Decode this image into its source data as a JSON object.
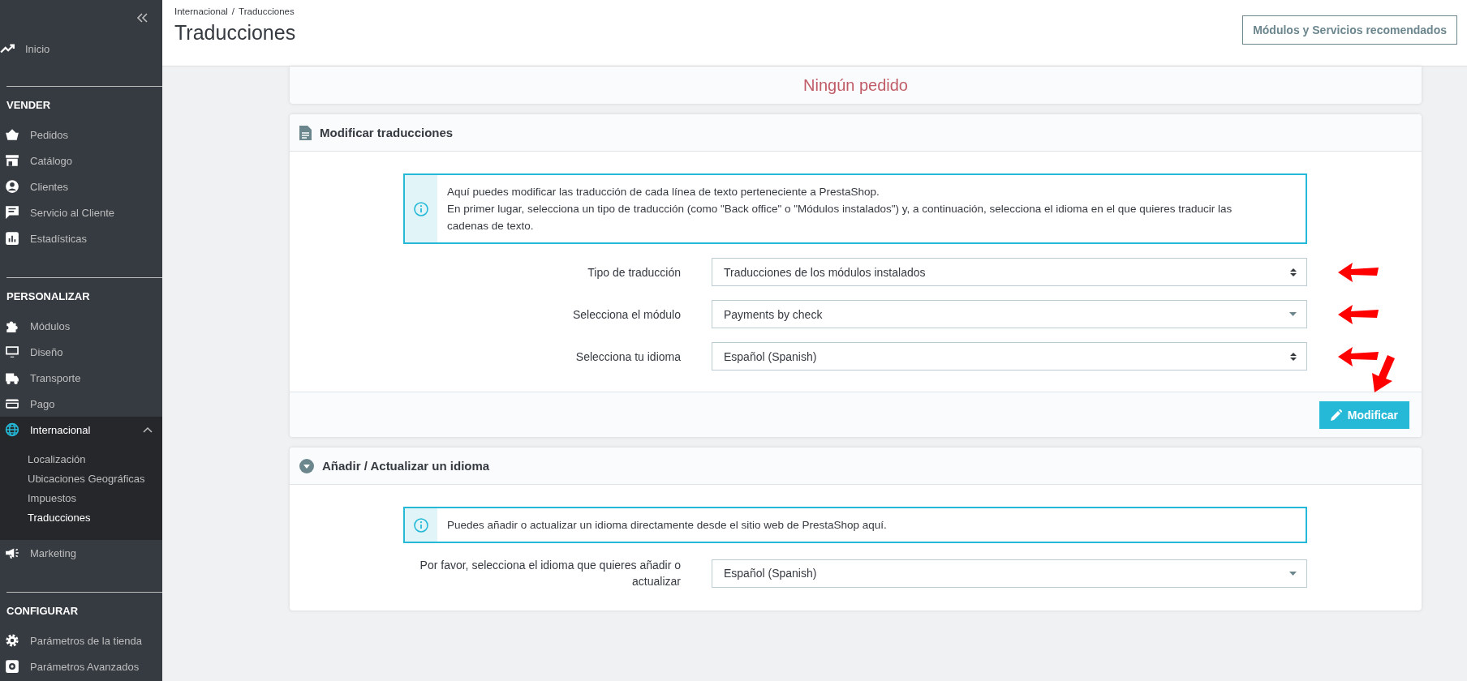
{
  "sidebar": {
    "sections": [
      {
        "items": [
          {
            "label": "Inicio",
            "selected": false
          }
        ]
      },
      {
        "heading": "VENDER",
        "items": [
          {
            "label": "Pedidos",
            "selected": false
          },
          {
            "label": "Catálogo",
            "selected": false
          },
          {
            "label": "Clientes",
            "selected": false
          },
          {
            "label": "Servicio al Cliente",
            "selected": false
          },
          {
            "label": "Estadísticas",
            "selected": false
          }
        ]
      },
      {
        "heading": "PERSONALIZAR",
        "items": [
          {
            "label": "Módulos",
            "selected": false
          },
          {
            "label": "Diseño",
            "selected": false
          },
          {
            "label": "Transporte",
            "selected": false
          },
          {
            "label": "Pago",
            "selected": false
          },
          {
            "label": "Internacional",
            "selected": true,
            "expanded": true,
            "children": [
              {
                "label": "Localización",
                "selected": false
              },
              {
                "label": "Ubicaciones Geográficas",
                "selected": false
              },
              {
                "label": "Impuestos",
                "selected": false
              },
              {
                "label": "Traducciones",
                "selected": true
              }
            ]
          },
          {
            "label": "Marketing",
            "selected": false
          }
        ]
      },
      {
        "heading": "CONFIGURAR",
        "items": [
          {
            "label": "Parámetros de la tienda",
            "selected": false
          },
          {
            "label": "Parámetros Avanzados",
            "selected": false
          }
        ]
      }
    ]
  },
  "header": {
    "breadcrumb": [
      "Internacional",
      "Traducciones"
    ],
    "separator": "/",
    "title": "Traducciones",
    "button": "Módulos y Servicios recomendados"
  },
  "orders_panel": {
    "message": "Ningún pedido"
  },
  "panels": [
    {
      "title": "Modificar traducciones",
      "info": [
        "Aquí puedes modificar las traducción de cada línea de texto perteneciente a PrestaShop.",
        "En primer lugar, selecciona un tipo de traducción (como \"Back office\" o \"Módulos instalados\") y, a continuación, selecciona el idioma en el que quieres traducir las cadenas de texto."
      ],
      "fields": [
        {
          "label": "Tipo de traducción",
          "value": "Traducciones de los módulos instalados",
          "kind": "spinner",
          "annotated": true
        },
        {
          "label": "Selecciona el módulo",
          "value": "Payments by check",
          "kind": "caret",
          "annotated": true
        },
        {
          "label": "Selecciona tu idioma",
          "value": "Español (Spanish)",
          "kind": "spinner",
          "annotated": true
        }
      ],
      "button": {
        "label": "Modificar",
        "annotated": true
      }
    },
    {
      "title": "Añadir / Actualizar un idioma",
      "info": [
        "Puedes añadir o actualizar un idioma directamente desde el sitio web de PrestaShop aquí."
      ],
      "fields": [
        {
          "label": "Por favor, selecciona el idioma que quieres añadir o actualizar",
          "value": "Español (Spanish)",
          "kind": "caret"
        }
      ]
    }
  ]
}
